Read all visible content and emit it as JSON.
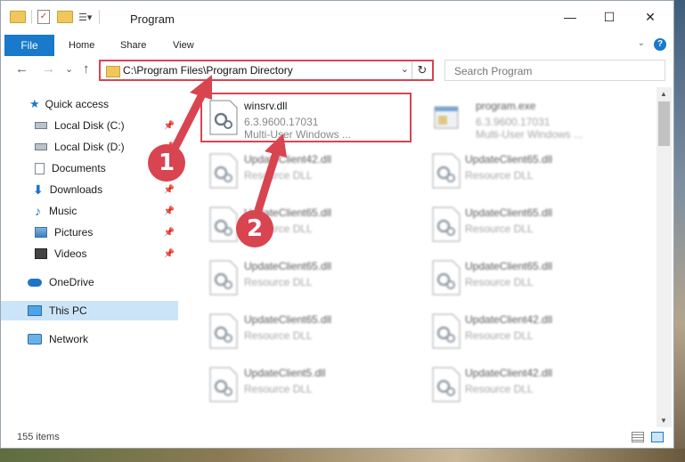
{
  "window": {
    "title": "Program",
    "controls": {
      "minimize": "—",
      "maximize": "☐",
      "close": "✕"
    }
  },
  "ribbon": {
    "tabs": [
      {
        "label": "File",
        "active": true
      },
      {
        "label": "Home"
      },
      {
        "label": "Share"
      },
      {
        "label": "View"
      }
    ],
    "help": "?"
  },
  "navigation": {
    "back_icon": "←",
    "forward_icon": "→",
    "recent_icon": "⌄",
    "up_icon": "↑",
    "address": "C:\\Program Files\\Program Directory",
    "search_placeholder": "Search Program"
  },
  "sidebar": {
    "items": [
      {
        "label": "Quick access",
        "icon": "star-icon",
        "pinned": false
      },
      {
        "label": "Local Disk (C:)",
        "icon": "drive-icon",
        "pinned": true
      },
      {
        "label": "Local Disk (D:)",
        "icon": "drive-icon",
        "pinned": true
      },
      {
        "label": "Documents",
        "icon": "documents-icon",
        "pinned": true
      },
      {
        "label": "Downloads",
        "icon": "download-icon",
        "pinned": true
      },
      {
        "label": "Music",
        "icon": "music-icon",
        "pinned": true
      },
      {
        "label": "Pictures",
        "icon": "pictures-icon",
        "pinned": true
      },
      {
        "label": "Videos",
        "icon": "videos-icon",
        "pinned": true
      },
      {
        "label": "OneDrive",
        "icon": "cloud-icon",
        "pinned": false
      },
      {
        "label": "This PC",
        "icon": "computer-icon",
        "pinned": false,
        "selected": true
      },
      {
        "label": "Network",
        "icon": "network-icon",
        "pinned": false
      }
    ]
  },
  "files": [
    {
      "name": "winsrv.dll",
      "version": "6.3.9600.17031",
      "description": "Multi-User Windows ...",
      "highlighted": true
    },
    {
      "name": "program.exe",
      "version": "6.3.9600.17031",
      "description": "Multi-User Windows ...",
      "blurred": true
    },
    {
      "name": "UpdateClient42.dll",
      "description": "Resource DLL",
      "blurred": true
    },
    {
      "name": "UpdateClient65.dll",
      "description": "Resource DLL",
      "blurred": true
    },
    {
      "name": "UpdateClient65.dll",
      "description": "Resource DLL",
      "blurred": true
    },
    {
      "name": "UpdateClient65.dll",
      "description": "Resource DLL",
      "blurred": true
    },
    {
      "name": "UpdateClient65.dll",
      "description": "Resource DLL",
      "blurred": true
    },
    {
      "name": "UpdateClient65.dll",
      "description": "Resource DLL",
      "blurred": true
    },
    {
      "name": "UpdateClient65.dll",
      "description": "Resource DLL",
      "blurred": true
    },
    {
      "name": "UpdateClient42.dll",
      "description": "Resource DLL",
      "blurred": true
    },
    {
      "name": "UpdateClient5.dll",
      "description": "Resource DLL",
      "blurred": true
    },
    {
      "name": "UpdateClient42.dll",
      "description": "Resource DLL",
      "blurred": true
    }
  ],
  "status": {
    "item_count": "155 items"
  },
  "annotations": {
    "step1": "1",
    "step2": "2",
    "color": "#d94451"
  },
  "colors": {
    "accent": "#1979ca",
    "highlight": "#d94451",
    "selected": "#cce4f7"
  }
}
